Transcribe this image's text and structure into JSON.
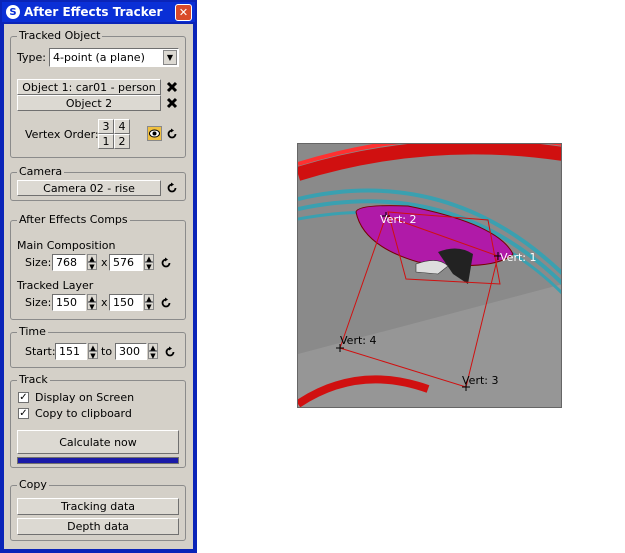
{
  "window": {
    "title": "After Effects Tracker",
    "close_glyph": "✕"
  },
  "tracked_object": {
    "legend": "Tracked Object",
    "type_label": "Type:",
    "type_value": "4-point (a plane)",
    "object1_button": "Object 1: car01 - person",
    "object2_button": "Object 2",
    "vertex_order_label": "Vertex Order:",
    "vertex_cells": [
      "3",
      "4",
      "1",
      "2"
    ]
  },
  "camera": {
    "legend": "Camera",
    "button": "Camera 02 - rise"
  },
  "comps": {
    "legend": "After Effects Comps",
    "main_label": "Main Composition",
    "main_size_label": "Size:",
    "main_width": "768",
    "main_height": "576",
    "layer_label": "Tracked Layer",
    "layer_size_label": "Size:",
    "layer_width": "150",
    "layer_height": "150",
    "times_glyph": "x"
  },
  "time": {
    "legend": "Time",
    "start_label": "Start:",
    "start_value": "151",
    "to_label": "to",
    "end_value": "300"
  },
  "track": {
    "legend": "Track",
    "display_label": "Display on Screen",
    "display_checked": true,
    "clipboard_label": "Copy to clipboard",
    "clipboard_checked": true,
    "calculate_button": "Calculate now",
    "progress": 1.0
  },
  "copy": {
    "legend": "Copy",
    "tracking_button": "Tracking data",
    "depth_button": "Depth data"
  },
  "viewport": {
    "labels": [
      "Vert: 2",
      "Vert: 1",
      "Vert: 4",
      "Vert: 3"
    ]
  },
  "icons": {
    "delete": "delete-x-icon",
    "reset": "reset-arrow-icon",
    "dropdown": "chevron-down-icon",
    "eye": "eye-icon"
  }
}
